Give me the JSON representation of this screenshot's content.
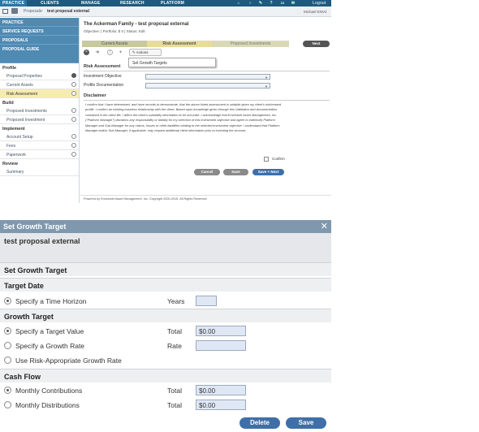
{
  "topnav": {
    "items": [
      "PRACTICE",
      "CLIENTS",
      "MANAGE",
      "RESEARCH",
      "PLATFORM"
    ],
    "logout": "Logout"
  },
  "subbar": {
    "crumb": "Proposals",
    "title": "test proposal external",
    "user": "Michael ENV2"
  },
  "sidebar": {
    "top": [
      "PRACTICE",
      "SERVICE REQUESTS",
      "PROPOSALS",
      "PROPOSAL GUIDE"
    ],
    "sections": [
      {
        "title": "Profile",
        "items": [
          "Proposal Properties",
          "Current Assets",
          "Risk Assessment"
        ]
      },
      {
        "title": "Build",
        "items": [
          "Proposed Investments",
          "Proposed Investment"
        ]
      },
      {
        "title": "Implement",
        "items": [
          "Account Setup",
          "Fees",
          "Paperwork"
        ]
      },
      {
        "title": "Review",
        "items": [
          "Summary"
        ]
      }
    ]
  },
  "main": {
    "title": "The Ackerman Family - test proposal external",
    "meta": "Objective:  |  Portfolio: $ 0  |  Status: Edit",
    "steps": [
      "Current Assets",
      "Risk Assessment",
      "Proposed Investments"
    ],
    "next": "Next",
    "actions": "Actions",
    "menu_item": "Set Growth Targets",
    "section": "Risk Assessment",
    "field1": "Investment Objective",
    "field2": "Profile Documentation",
    "disclaimer_title": "Disclaimer",
    "disclaimer": "I confirm that I have determined, and have records to demonstrate, that the above-listed assessment is suitable given my client's risk/reward profile. I confirm an existing business relationship with the client. Based upon knowledge given through this Validation and documentation contained in the client file, I affirm the client's suitability information to be accurate. I acknowledge that Envestnet Asset Management, Inc. (\"Platform Manager\") disclaims any responsibility or liability for my selection of this investment objective and agree to indemnify Platform Manager and Sub-Manager for any claims, losses or other liabilities relating to the selected investment objective. I understand that Platform Manager and/or Sub-Manager, if applicable, may request additional client information prior to investing the account.",
    "confirm": "Confirm",
    "cancel": "Cancel",
    "save": "Save",
    "save_next": "Save + Next",
    "footer": "Powered by Envestnet Asset Management, Inc. Copyright 2000-2015. All Rights Reserved."
  },
  "dialog": {
    "title": "Set Growth Target",
    "close": "✕",
    "proposal": "test proposal external",
    "heading": "Set Growth Target",
    "target_date": {
      "title": "Target Date",
      "option": "Specify a Time Horizon",
      "label": "Years",
      "value": ""
    },
    "growth_target": {
      "title": "Growth Target",
      "options": [
        "Specify a Target Value",
        "Specify a Growth Rate",
        "Use Risk-Appropriate Growth Rate"
      ],
      "total_label": "Total",
      "total_value": "$0.00",
      "rate_label": "Rate",
      "rate_value": ""
    },
    "cash_flow": {
      "title": "Cash Flow",
      "options": [
        "Monthly Contributions",
        "Monthly Distributions"
      ],
      "contrib_label": "Total",
      "contrib_value": "$0.00",
      "distrib_label": "Total",
      "distrib_value": "$0.00"
    },
    "delete": "Delete",
    "save": "Save"
  }
}
